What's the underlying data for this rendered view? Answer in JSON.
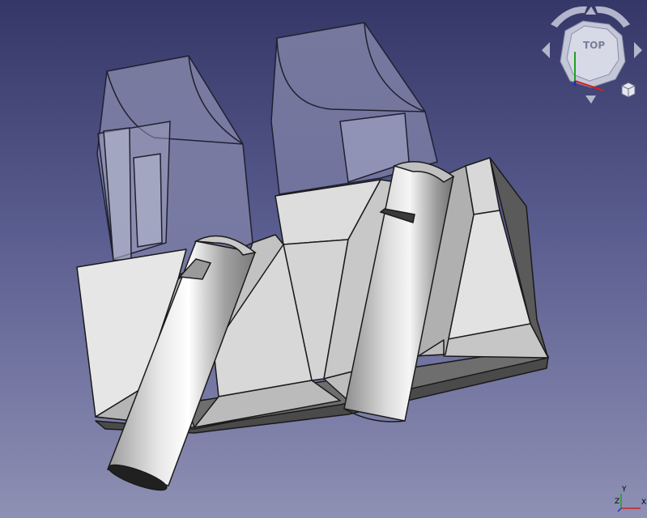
{
  "viewport": {
    "background_top": "#343767",
    "background_bottom": "#8e90b4"
  },
  "model": {
    "solid_face_light": "#dcdcdc",
    "solid_face_mid": "#b9b9b9",
    "solid_face_dark": "#6b6b6b",
    "transparent_tint": "#9a9cbc",
    "edge_color": "#1a1a1a"
  },
  "navcube": {
    "face_label": "TOP",
    "arrows": [
      "rotate-left-icon",
      "rotate-right-icon",
      "up-arrow-icon",
      "down-arrow-icon",
      "left-arrow-icon",
      "right-arrow-icon"
    ],
    "menu_icon": "view-menu-cube-icon"
  },
  "axis_indicator": {
    "y_label": "Y",
    "z_label": "Z",
    "x_label": "X",
    "x_color": "#d22020",
    "y_color": "#20a020",
    "z_color": "#2030c0"
  }
}
